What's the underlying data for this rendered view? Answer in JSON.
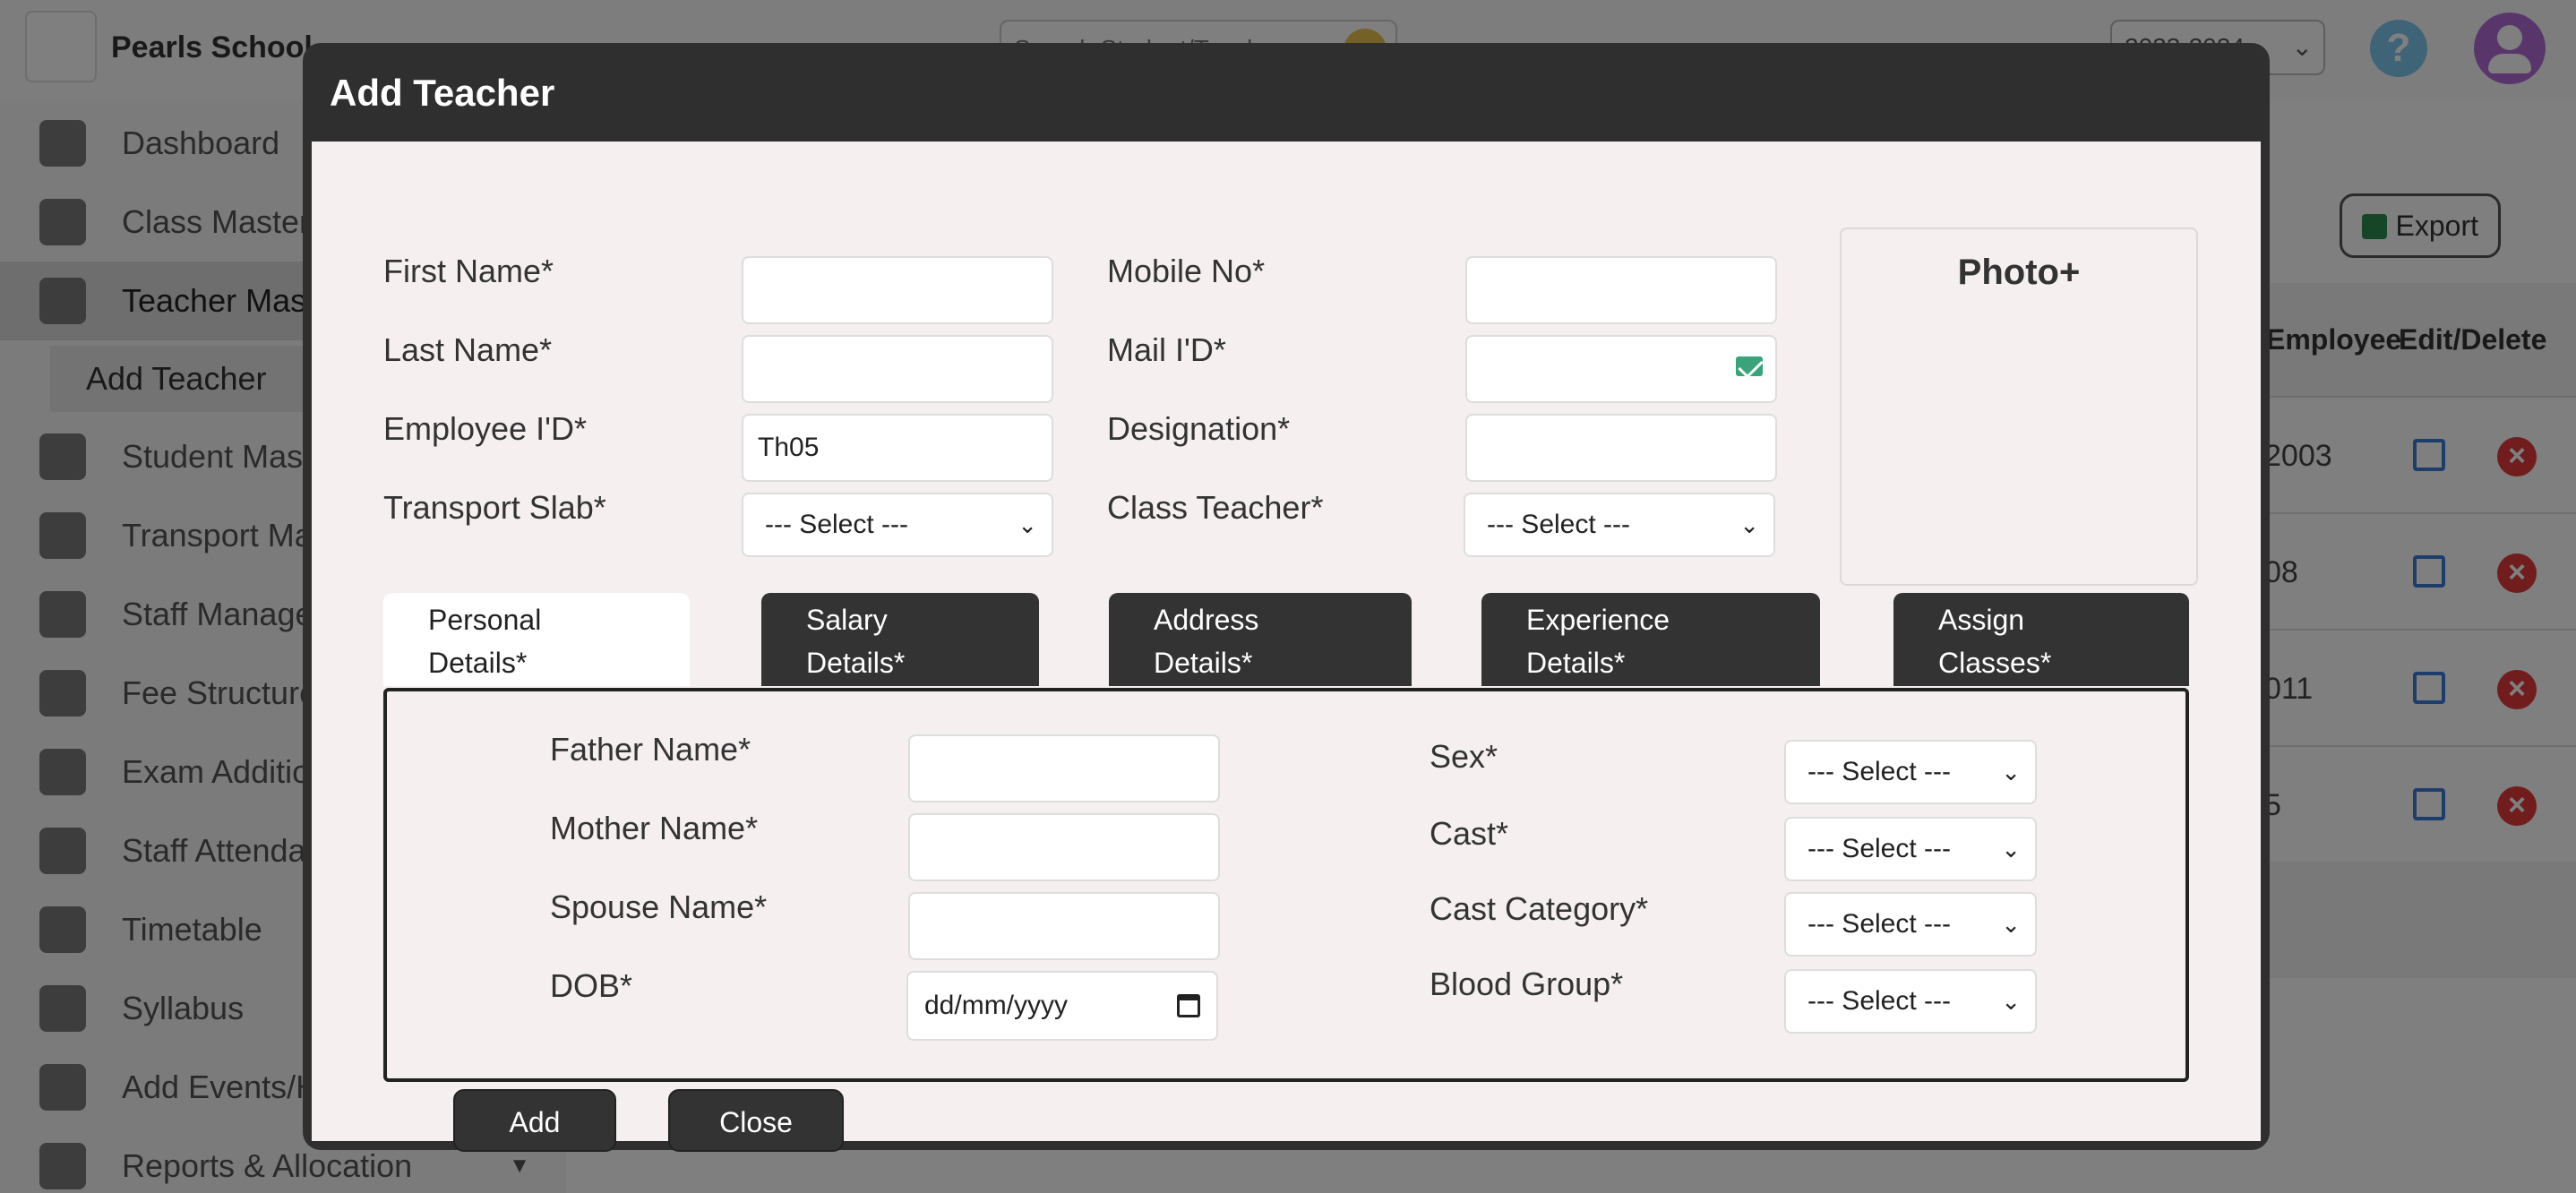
{
  "app": {
    "school_name": "Pearls School",
    "search_placeholder": "Search Student/Teacher",
    "academic_year": "2023-2024",
    "help_symbol": "?"
  },
  "sidebar": {
    "items": [
      {
        "label": "Dashboard",
        "icon": "dashboard-icon"
      },
      {
        "label": "Class Master",
        "icon": "class-icon"
      },
      {
        "label": "Teacher Master",
        "icon": "teacher-icon"
      },
      {
        "label": "Student Master",
        "icon": "student-icon"
      },
      {
        "label": "Transport Master",
        "icon": "bus-icon"
      },
      {
        "label": "Staff Management",
        "icon": "staff-icon"
      },
      {
        "label": "Fee Structure",
        "icon": "fee-icon"
      },
      {
        "label": "Exam Addition",
        "icon": "exam-icon"
      },
      {
        "label": "Staff Attendance",
        "icon": "attendance-icon"
      },
      {
        "label": "Timetable",
        "icon": "timetable-icon"
      },
      {
        "label": "Syllabus",
        "icon": "syllabus-icon"
      },
      {
        "label": "Add Events/Holidays",
        "icon": "events-icon"
      },
      {
        "label": "Reports & Allocation",
        "icon": "reports-icon"
      }
    ],
    "sub_item": "Add Teacher"
  },
  "background_table": {
    "export_label": "Export",
    "headers": {
      "employee": "Employee",
      "actions": "Edit/Delete"
    },
    "rows": [
      "2003",
      "08",
      "011",
      "5"
    ]
  },
  "modal": {
    "title": "Add Teacher",
    "fields": {
      "first_name": {
        "label": "First Name*",
        "value": ""
      },
      "last_name": {
        "label": "Last Name*",
        "value": ""
      },
      "employee_id": {
        "label": "Employee I'D*",
        "value": "Th05"
      },
      "transport_slab": {
        "label": "Transport Slab*",
        "value": "--- Select ---"
      },
      "mobile_no": {
        "label": "Mobile No*",
        "value": ""
      },
      "mail_id": {
        "label": "Mail I'D*",
        "value": ""
      },
      "designation": {
        "label": "Designation*",
        "value": ""
      },
      "class_teacher": {
        "label": "Class Teacher*",
        "value": "--- Select ---"
      }
    },
    "photo_label": "Photo+",
    "tabs": [
      {
        "line1": "Personal",
        "line2": "Details*",
        "active": true
      },
      {
        "line1": "Salary",
        "line2": "Details*",
        "active": false
      },
      {
        "line1": "Address",
        "line2": "Details*",
        "active": false
      },
      {
        "line1": "Experience",
        "line2": "Details*",
        "active": false
      },
      {
        "line1": "Assign",
        "line2": "Classes*",
        "active": false
      }
    ],
    "personal": {
      "father_name": {
        "label": "Father Name*",
        "value": ""
      },
      "mother_name": {
        "label": "Mother Name*",
        "value": ""
      },
      "spouse_name": {
        "label": "Spouse Name*",
        "value": ""
      },
      "dob": {
        "label": "DOB*",
        "value": "dd/mm/yyyy"
      },
      "sex": {
        "label": "Sex*",
        "value": "--- Select ---"
      },
      "cast": {
        "label": "Cast*",
        "value": "--- Select ---"
      },
      "cast_category": {
        "label": "Cast Category*",
        "value": "--- Select ---"
      },
      "blood_group": {
        "label": "Blood Group*",
        "value": "--- Select ---"
      }
    },
    "buttons": {
      "add": "Add",
      "close": "Close"
    }
  },
  "colors": {
    "modal_frame": "#2f2f2f",
    "modal_body": "#f5efef",
    "tab_inactive": "#333333",
    "tab_active": "#ffffff"
  }
}
